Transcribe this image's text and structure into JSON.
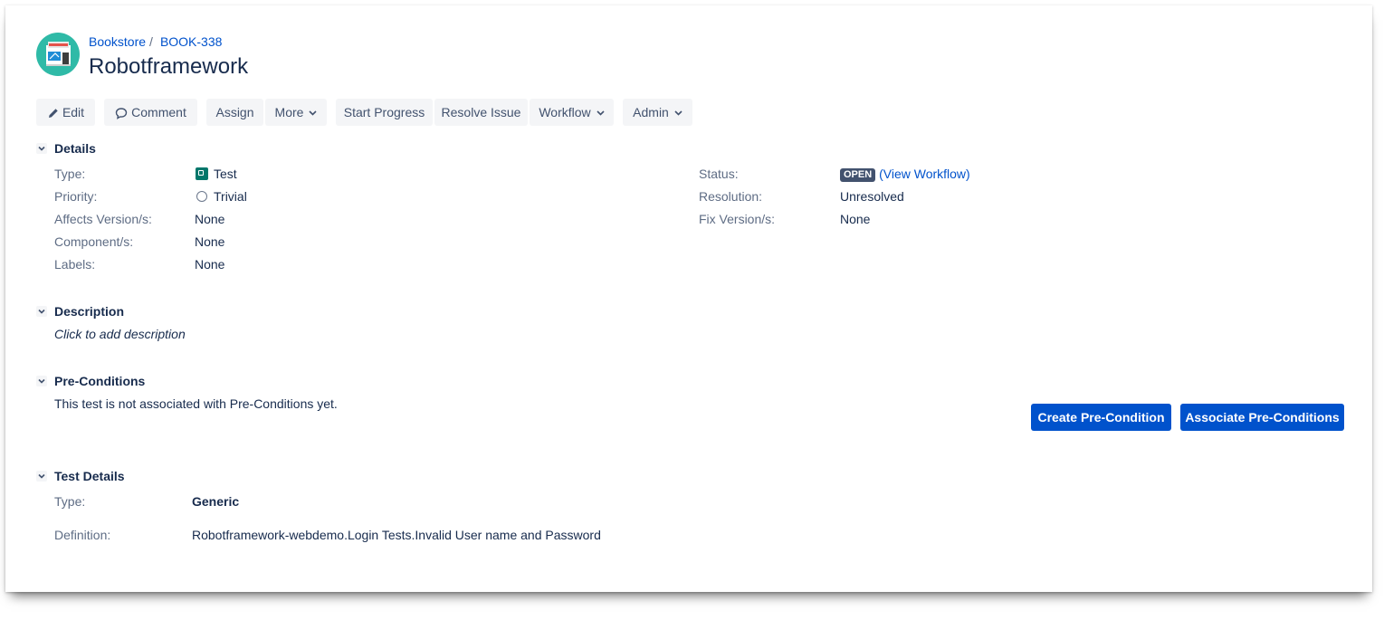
{
  "project": {
    "name": "Bookstore",
    "avatar_icon": "bookstore-icon"
  },
  "issue": {
    "key": "BOOK-338",
    "title": "Robotframework"
  },
  "toolbar": {
    "edit": "Edit",
    "comment": "Comment",
    "assign": "Assign",
    "more": "More",
    "start_progress": "Start Progress",
    "resolve_issue": "Resolve Issue",
    "workflow": "Workflow",
    "admin": "Admin"
  },
  "details": {
    "heading": "Details",
    "left": [
      {
        "label": "Type:",
        "value": "Test"
      },
      {
        "label": "Priority:",
        "value": "Trivial"
      },
      {
        "label": "Affects Version/s:",
        "value": "None"
      },
      {
        "label": "Component/s:",
        "value": "None"
      },
      {
        "label": "Labels:",
        "value": "None"
      }
    ],
    "right": [
      {
        "label": "Status:",
        "lozenge": "OPEN",
        "link_open": "(",
        "link": "View Workflow",
        "link_close": ")"
      },
      {
        "label": "Resolution:",
        "value": "Unresolved"
      },
      {
        "label": "Fix Version/s:",
        "value": "None"
      }
    ]
  },
  "description": {
    "heading": "Description",
    "placeholder": "Click to add description"
  },
  "preconditions": {
    "heading": "Pre-Conditions",
    "message": "This test is not associated with Pre-Conditions yet.",
    "create_button": "Create Pre-Condition",
    "associate_button": "Associate Pre-Conditions"
  },
  "test_details": {
    "heading": "Test Details",
    "type_label": "Type:",
    "type_value": "Generic",
    "definition_label": "Definition:",
    "definition_value": "Robotframework-webdemo.Login Tests.Invalid User name and Password"
  },
  "colors": {
    "primary": "#0052cc",
    "lozenge": "#42526e",
    "type_icon": "#00776b",
    "avatar": "#2fbaa7"
  }
}
